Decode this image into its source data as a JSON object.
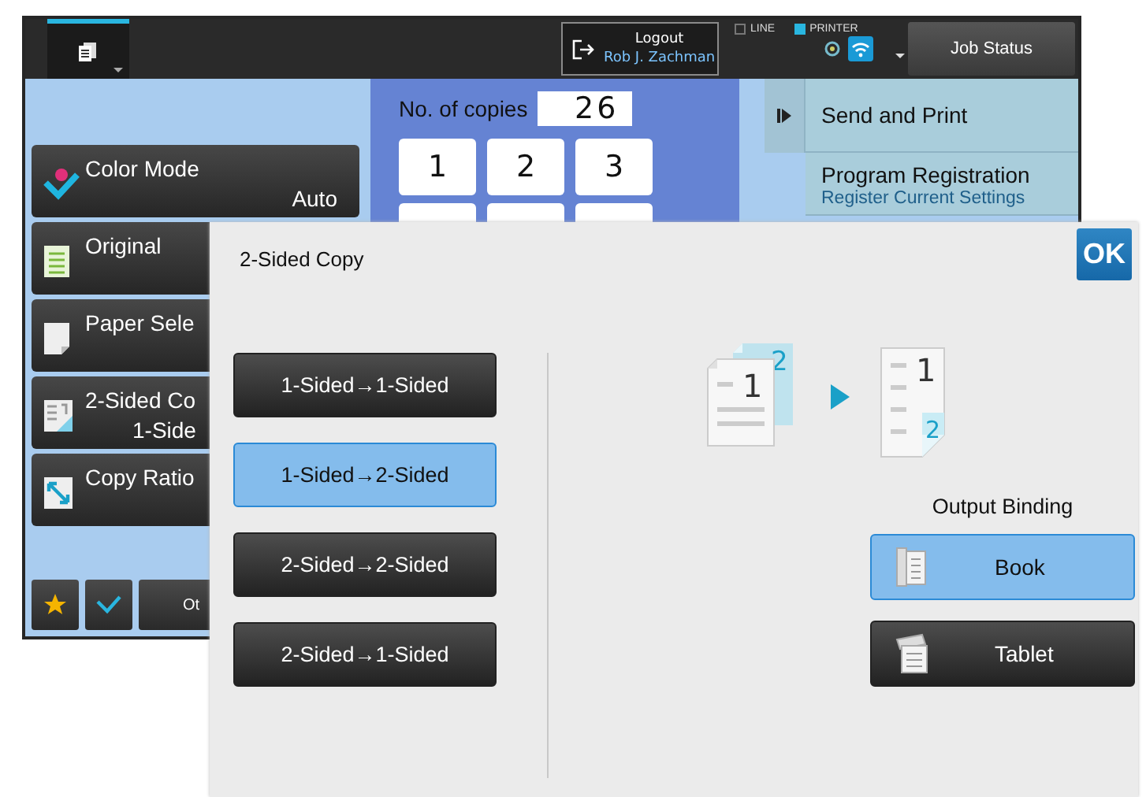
{
  "top_bar": {
    "logout": {
      "label": "Logout",
      "user": "Rob J. Zachman"
    },
    "indicators": [
      {
        "label": "LINE",
        "on": false
      },
      {
        "label": "PRINTER",
        "on": true
      }
    ],
    "job_status": "Job Status"
  },
  "copies": {
    "label": "No. of copies",
    "value": "26",
    "keys": [
      "1",
      "2",
      "3"
    ]
  },
  "right_menu": [
    {
      "title": "Send and Print"
    },
    {
      "title": "Program Registration",
      "subtitle": "Register Current Settings"
    }
  ],
  "functions": [
    {
      "kind": "color",
      "label": "Color Mode",
      "value": "Auto"
    },
    {
      "kind": "original",
      "label": "Original"
    },
    {
      "kind": "paper",
      "label": "Paper Sele"
    },
    {
      "kind": "duplex",
      "label": "2-Sided Co",
      "value": "1-Side"
    },
    {
      "kind": "ratio",
      "label": "Copy Ratio"
    }
  ],
  "bottom_bar": {
    "other": "Ot"
  },
  "dialog": {
    "title": "2-Sided Copy",
    "ok": "OK",
    "diagram": {
      "source_back": "2",
      "source_front": "1",
      "output_front": "1",
      "output_back": "2"
    },
    "modes": [
      {
        "label": "1-Sided→1-Sided",
        "selected": false
      },
      {
        "label": "1-Sided→2-Sided",
        "selected": true
      },
      {
        "label": "2-Sided→2-Sided",
        "selected": false
      },
      {
        "label": "2-Sided→1-Sided",
        "selected": false
      }
    ],
    "binding": {
      "label": "Output Binding",
      "options": [
        {
          "kind": "book",
          "label": "Book",
          "selected": true
        },
        {
          "kind": "tablet",
          "label": "Tablet",
          "selected": false
        }
      ]
    }
  }
}
